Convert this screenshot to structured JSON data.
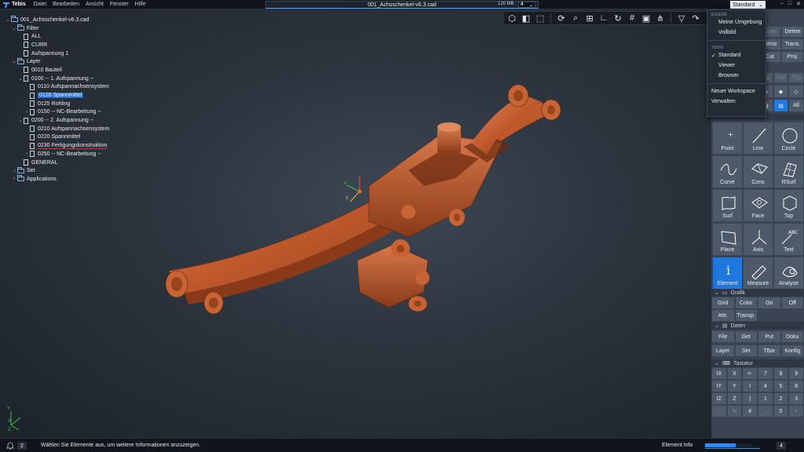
{
  "app": {
    "name": "Tebis"
  },
  "menu": [
    "Datei",
    "Bearbeiten",
    "Ansicht",
    "Fenster",
    "Hilfe"
  ],
  "document": {
    "title": "001_Achsschenkel-v6.3.cad",
    "memory": "120 MB",
    "view_count": "4"
  },
  "workspace": {
    "selected": "Standard"
  },
  "tree": [
    {
      "label": "001_Achsschenkel-v6.3.cad",
      "level": 0,
      "type": "folder",
      "twisty": "v"
    },
    {
      "label": "Filter",
      "level": 1,
      "type": "folder",
      "twisty": "v"
    },
    {
      "label": "ALL",
      "level": 2,
      "type": "doc",
      "twisty": ""
    },
    {
      "label": "CURR",
      "level": 2,
      "type": "doc",
      "twisty": ""
    },
    {
      "label": "Aufspannung 1",
      "level": 2,
      "type": "doc",
      "twisty": ""
    },
    {
      "label": "Layer",
      "level": 1,
      "type": "folder",
      "twisty": "v"
    },
    {
      "label": "0010 Bauteil",
      "level": 2,
      "type": "doc",
      "twisty": ""
    },
    {
      "label": "0100 -- 1. Aufspannung --",
      "level": 2,
      "type": "doc",
      "twisty": "v"
    },
    {
      "label": "0110 Aufspannachsensystem",
      "level": 3,
      "type": "doc",
      "twisty": ""
    },
    {
      "label": "0120 Spannmittel",
      "level": 3,
      "type": "doc",
      "twisty": "",
      "selected": true
    },
    {
      "label": "0125 Rohling",
      "level": 3,
      "type": "doc",
      "twisty": ""
    },
    {
      "label": "0150 -- NC-Bearbeitung --",
      "level": 3,
      "type": "doc",
      "twisty": ">"
    },
    {
      "label": "0200 -- 2. Aufspannung --",
      "level": 2,
      "type": "doc",
      "twisty": "v"
    },
    {
      "label": "0210 Aufspannachsensystem",
      "level": 3,
      "type": "doc",
      "twisty": ""
    },
    {
      "label": "0220 Spannmittel",
      "level": 3,
      "type": "doc",
      "twisty": ""
    },
    {
      "label": "0230 Fertigungskonstruktion",
      "level": 3,
      "type": "doc",
      "twisty": "",
      "underline": true
    },
    {
      "label": "0250 -- NC-Bearbeitung --",
      "level": 3,
      "type": "doc",
      "twisty": ">"
    },
    {
      "label": "GENERAL",
      "level": 2,
      "type": "doc",
      "twisty": ""
    },
    {
      "label": "Set",
      "level": 1,
      "type": "folder",
      "twisty": ">"
    },
    {
      "label": "Applications",
      "level": 1,
      "type": "folder",
      "twisty": ">"
    }
  ],
  "dropdown": {
    "eigene_header": "EIGENE",
    "eigene_items": [
      "Meine Umgebung",
      "Vollbild"
    ],
    "tebis_header": "TEBIS",
    "tebis_items": [
      "Standard",
      "Viewer",
      "Browser"
    ],
    "checked": "Standard",
    "extra_items": [
      "Neuer Workspace",
      "Verwalten"
    ]
  },
  "right_panel": {
    "top_row1": [
      "Scale",
      "Delete"
    ],
    "top_row2": [
      "Mirror",
      "Trans."
    ],
    "top_row3": [
      "Cut",
      "Proj."
    ],
    "dim_row": [
      "Tip",
      "Col",
      "Trp"
    ],
    "all_label": "All",
    "design_buttons": [
      "Point",
      "Line",
      "Circle",
      "Curve",
      "Cons",
      "RSurf",
      "Surf",
      "Face",
      "Top",
      "Plane",
      "Axis",
      "Text",
      "Element",
      "Measure",
      "Analyse"
    ],
    "active_button": "Element",
    "grafik_header": "Grafik",
    "grafik_buttons": [
      "Grid",
      "Color",
      "On",
      "Off",
      "Attr.",
      "Transp."
    ],
    "daten_header": "Daten",
    "daten_buttons": [
      "File",
      "Get",
      "Put",
      "Doku",
      "Layer",
      "Set",
      "TBar",
      "Konfig"
    ],
    "tastatur_header": "Tastatur",
    "tastatur_keys": [
      "IX",
      "X",
      "<-",
      "7",
      "8",
      "9",
      "IY",
      "Y",
      "I",
      "4",
      "5",
      "6",
      "IZ",
      "Z",
      "|",
      "1",
      "2",
      "3",
      ":",
      "N",
      "#",
      ".",
      "0",
      "-"
    ]
  },
  "axis_labels": {
    "x": "X",
    "y": "Y",
    "z": "Z"
  },
  "status": {
    "notification_count": "2",
    "message": "Wählen Sie Elemente aus, um weitere Informationen anzuzeigen.",
    "element_info": "Element Info",
    "progress": 0.65,
    "page": "4"
  },
  "colors": {
    "accent": "#1f78e0",
    "part": "#c8602e",
    "panel": "#3a4452"
  }
}
